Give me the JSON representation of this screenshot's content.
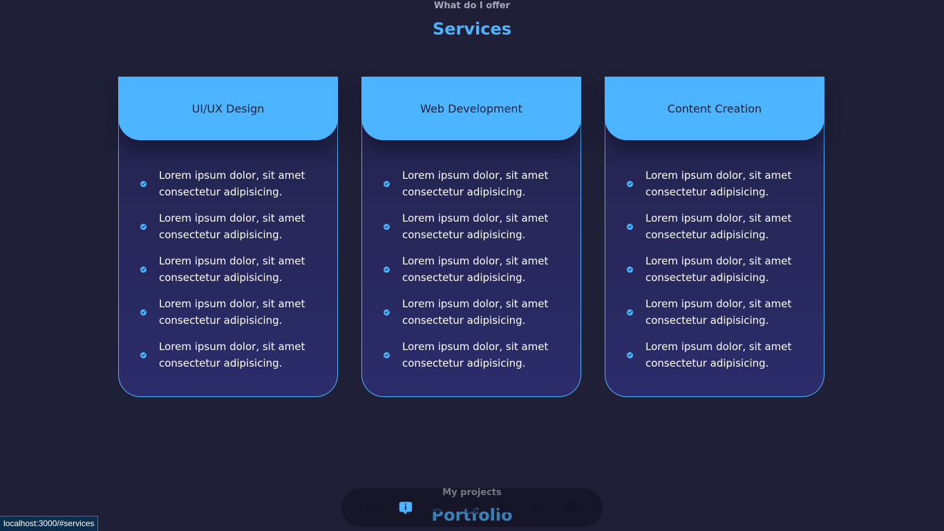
{
  "services_section": {
    "subtitle": "What do I offer",
    "title": "Services"
  },
  "cards": [
    {
      "title": "UI/UX Design",
      "items": [
        "Lorem ipsum dolor, sit amet consectetur adipisicing.",
        "Lorem ipsum dolor, sit amet consectetur adipisicing.",
        "Lorem ipsum dolor, sit amet consectetur adipisicing.",
        "Lorem ipsum dolor, sit amet consectetur adipisicing.",
        "Lorem ipsum dolor, sit amet consectetur adipisicing."
      ]
    },
    {
      "title": "Web Development",
      "items": [
        "Lorem ipsum dolor, sit amet consectetur adipisicing.",
        "Lorem ipsum dolor, sit amet consectetur adipisicing.",
        "Lorem ipsum dolor, sit amet consectetur adipisicing.",
        "Lorem ipsum dolor, sit amet consectetur adipisicing.",
        "Lorem ipsum dolor, sit amet consectetur adipisicing."
      ]
    },
    {
      "title": "Content Creation",
      "items": [
        "Lorem ipsum dolor, sit amet consectetur adipisicing.",
        "Lorem ipsum dolor, sit amet consectetur adipisicing.",
        "Lorem ipsum dolor, sit amet consectetur adipisicing.",
        "Lorem ipsum dolor, sit amet consectetur adipisicing.",
        "Lorem ipsum dolor, sit amet consectetur adipisicing."
      ]
    }
  ],
  "portfolio_section": {
    "subtitle": "My projects",
    "title": "Portfolio"
  },
  "nav": {
    "items": [
      {
        "icon": "home-icon",
        "active": false
      },
      {
        "icon": "about-icon",
        "active": true
      },
      {
        "icon": "book-icon",
        "active": false
      },
      {
        "icon": "services-icon",
        "active": false
      },
      {
        "icon": "folder-icon",
        "active": false
      },
      {
        "icon": "quote-icon",
        "active": false
      },
      {
        "icon": "mail-icon",
        "active": false
      }
    ]
  },
  "status_bar": {
    "url": "localhost:3000/#services"
  },
  "colors": {
    "background": "#1f1f38",
    "primary": "#4db5ff",
    "card_bg": "#2c2c6c"
  }
}
